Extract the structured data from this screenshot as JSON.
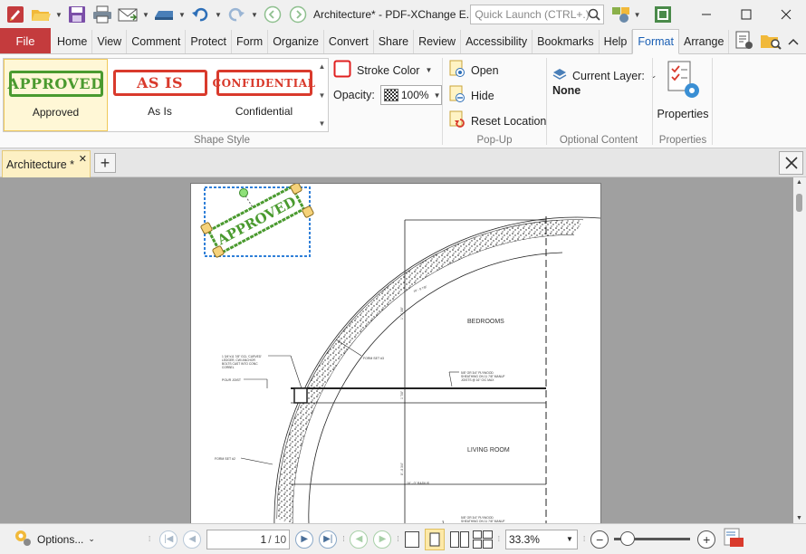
{
  "app": {
    "title": "Architecture* - PDF-XChange E...",
    "quick_launch_placeholder": "Quick Launch (CTRL+.)"
  },
  "ribbon_tabs": [
    {
      "label": "Home"
    },
    {
      "label": "View"
    },
    {
      "label": "Comment"
    },
    {
      "label": "Protect"
    },
    {
      "label": "Form"
    },
    {
      "label": "Organize"
    },
    {
      "label": "Convert"
    },
    {
      "label": "Share"
    },
    {
      "label": "Review"
    },
    {
      "label": "Accessibility"
    },
    {
      "label": "Bookmarks"
    },
    {
      "label": "Help"
    },
    {
      "label": "Format",
      "active": true
    },
    {
      "label": "Arrange"
    }
  ],
  "file_tab": "File",
  "shape_style": {
    "group_label": "Shape Style",
    "stamps": [
      {
        "stamp_text": "APPROVED",
        "label": "Approved",
        "color": "#4a9a2f",
        "selected": true
      },
      {
        "stamp_text": "AS IS",
        "label": "As Is",
        "color": "#d93a2c",
        "selected": false
      },
      {
        "stamp_text": "CONFIDENTIAL",
        "label": "Confidential",
        "color": "#d93a2c",
        "selected": false
      }
    ],
    "stroke_color_label": "Stroke Color",
    "stroke_color": "#e02020",
    "opacity_label": "Opacity:",
    "opacity_value": "100%"
  },
  "popup": {
    "group_label": "Pop-Up",
    "open_label": "Open",
    "hide_label": "Hide",
    "reset_label": "Reset Location"
  },
  "optional_content": {
    "group_label": "Optional Content",
    "current_layer_label": "Current Layer:",
    "current_layer_value": "None"
  },
  "properties": {
    "group_label": "Properties",
    "button_label": "Properties"
  },
  "document_tab": {
    "label": "Architecture *"
  },
  "drawing": {
    "stamp_text": "APPROVED",
    "labels": {
      "bedrooms": "BEDROOMS",
      "living_room": "LIVING ROOM",
      "form_set_3": "FORM SET #3",
      "form_set_2": "FORM SET #2",
      "pour_joist": "POUR JOIST",
      "radius": "16' - 0\" RADIUS",
      "note_ledger": [
        "1 3/4\"x11 7/8\" GCL 'CURVED'",
        "LEDGER, CW/ ANCHOR",
        "BOLTS CAST INTO CONC",
        "CORBEL"
      ],
      "note_plywood_1": [
        "5/8\" OR 3/4\" PLYWOOD",
        "SHEATHING ON 11 7/8\" MANUF",
        "JOISTS @ 16\" O/C MAX"
      ],
      "note_plywood_2": [
        "5/8\" OR 3/4\" PLYWOOD",
        "SHEATHING ON 11 7/8\" MANUF"
      ],
      "dim_1": "10' - 8 7/8\"",
      "dim_2": "1' - 1 3/8\"",
      "dim_3": "1' 7/8\"",
      "dim_4": "8' - 8 3/4\""
    }
  },
  "statusbar": {
    "options_label": "Options...",
    "current_page": "1",
    "total_pages": "/ 10",
    "zoom_value": "33.3%",
    "zoom_slider_fraction": 0.1
  }
}
